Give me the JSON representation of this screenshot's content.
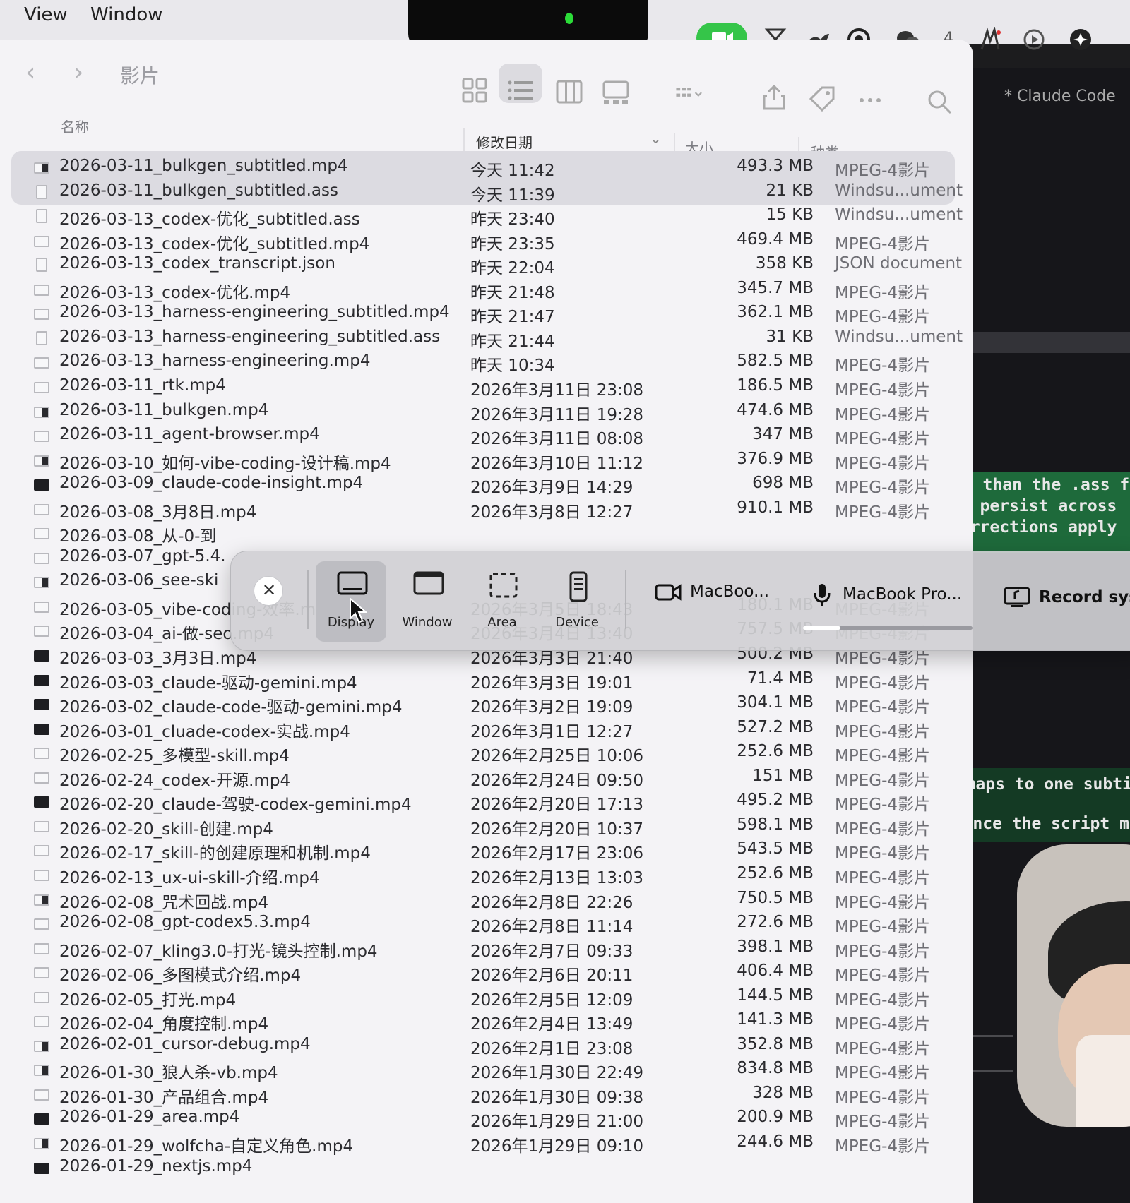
{
  "menubar": {
    "view_label": "View",
    "window_label": "Window",
    "status_count": "4"
  },
  "finder": {
    "title": "影片",
    "columns": {
      "name": "名称",
      "date": "修改日期",
      "size": "大小",
      "kind": "种类"
    },
    "rows": [
      {
        "name": "2026-03-11_bulkgen_subtitled.mp4",
        "date": "今天 11:42",
        "size": "493.3 MB",
        "kind": "MPEG-4影片",
        "icon": "video-thumb",
        "selected": true
      },
      {
        "name": "2026-03-11_bulkgen_subtitled.ass",
        "date": "今天 11:39",
        "size": "21 KB",
        "kind": "Windsu...ument",
        "icon": "doc"
      },
      {
        "name": "2026-03-13_codex-优化_subtitled.ass",
        "date": "昨天 23:40",
        "size": "15 KB",
        "kind": "Windsu...ument",
        "icon": "doc"
      },
      {
        "name": "2026-03-13_codex-优化_subtitled.mp4",
        "date": "昨天 23:35",
        "size": "469.4 MB",
        "kind": "MPEG-4影片",
        "icon": "video"
      },
      {
        "name": "2026-03-13_codex_transcript.json",
        "date": "昨天 22:04",
        "size": "358 KB",
        "kind": "JSON document",
        "icon": "doc"
      },
      {
        "name": "2026-03-13_codex-优化.mp4",
        "date": "昨天 21:48",
        "size": "345.7 MB",
        "kind": "MPEG-4影片",
        "icon": "video"
      },
      {
        "name": "2026-03-13_harness-engineering_subtitled.mp4",
        "date": "昨天 21:47",
        "size": "362.1 MB",
        "kind": "MPEG-4影片",
        "icon": "video"
      },
      {
        "name": "2026-03-13_harness-engineering_subtitled.ass",
        "date": "昨天 21:44",
        "size": "31 KB",
        "kind": "Windsu...ument",
        "icon": "doc"
      },
      {
        "name": "2026-03-13_harness-engineering.mp4",
        "date": "昨天 10:34",
        "size": "582.5 MB",
        "kind": "MPEG-4影片",
        "icon": "video"
      },
      {
        "name": "2026-03-11_rtk.mp4",
        "date": "2026年3月11日 23:08",
        "size": "186.5 MB",
        "kind": "MPEG-4影片",
        "icon": "video"
      },
      {
        "name": "2026-03-11_bulkgen.mp4",
        "date": "2026年3月11日 19:28",
        "size": "474.6 MB",
        "kind": "MPEG-4影片",
        "icon": "video-thumb"
      },
      {
        "name": "2026-03-11_agent-browser.mp4",
        "date": "2026年3月11日 08:08",
        "size": "347 MB",
        "kind": "MPEG-4影片",
        "icon": "video"
      },
      {
        "name": "2026-03-10_如何-vibe-coding-设计稿.mp4",
        "date": "2026年3月10日 11:12",
        "size": "376.9 MB",
        "kind": "MPEG-4影片",
        "icon": "video-thumb"
      },
      {
        "name": "2026-03-09_claude-code-insight.mp4",
        "date": "2026年3月9日 14:29",
        "size": "698 MB",
        "kind": "MPEG-4影片",
        "icon": "video-dark"
      },
      {
        "name": "2026-03-08_3月8日.mp4",
        "date": "2026年3月8日 12:27",
        "size": "910.1 MB",
        "kind": "MPEG-4影片",
        "icon": "video"
      },
      {
        "name": "2026-03-08_从-0-到",
        "date": "",
        "size": "",
        "kind": "",
        "icon": "video"
      },
      {
        "name": "2026-03-07_gpt-5.4.",
        "date": "",
        "size": "",
        "kind": "",
        "icon": "video"
      },
      {
        "name": "2026-03-06_see-ski",
        "date": "",
        "size": "",
        "kind": "",
        "icon": "video-thumb"
      },
      {
        "name": "2026-03-05_vibe-coding-效率.mp4",
        "date": "2026年3月5日 18:43",
        "size": "180.1 MB",
        "kind": "MPEG-4影片",
        "icon": "video"
      },
      {
        "name": "2026-03-04_ai-做-seo.mp4",
        "date": "2026年3月4日 13:40",
        "size": "757.5 MB",
        "kind": "MPEG-4影片",
        "icon": "video"
      },
      {
        "name": "2026-03-03_3月3日.mp4",
        "date": "2026年3月3日 21:40",
        "size": "500.2 MB",
        "kind": "MPEG-4影片",
        "icon": "video-dark"
      },
      {
        "name": "2026-03-03_claude-驱动-gemini.mp4",
        "date": "2026年3月3日 19:01",
        "size": "71.4 MB",
        "kind": "MPEG-4影片",
        "icon": "video-dark"
      },
      {
        "name": "2026-03-02_claude-code-驱动-gemini.mp4",
        "date": "2026年3月2日 19:09",
        "size": "304.1 MB",
        "kind": "MPEG-4影片",
        "icon": "video-dark"
      },
      {
        "name": "2026-03-01_cluade-codex-实战.mp4",
        "date": "2026年3月1日 12:27",
        "size": "527.2 MB",
        "kind": "MPEG-4影片",
        "icon": "video-dark"
      },
      {
        "name": "2026-02-25_多模型-skill.mp4",
        "date": "2026年2月25日 10:06",
        "size": "252.6 MB",
        "kind": "MPEG-4影片",
        "icon": "video"
      },
      {
        "name": "2026-02-24_codex-开源.mp4",
        "date": "2026年2月24日 09:50",
        "size": "151 MB",
        "kind": "MPEG-4影片",
        "icon": "video"
      },
      {
        "name": "2026-02-20_claude-驾驶-codex-gemini.mp4",
        "date": "2026年2月20日 17:13",
        "size": "495.2 MB",
        "kind": "MPEG-4影片",
        "icon": "video-dark"
      },
      {
        "name": "2026-02-20_skill-创建.mp4",
        "date": "2026年2月20日 10:37",
        "size": "598.1 MB",
        "kind": "MPEG-4影片",
        "icon": "video"
      },
      {
        "name": "2026-02-17_skill-的创建原理和机制.mp4",
        "date": "2026年2月17日 23:06",
        "size": "543.5 MB",
        "kind": "MPEG-4影片",
        "icon": "video"
      },
      {
        "name": "2026-02-13_ux-ui-skill-介绍.mp4",
        "date": "2026年2月13日 13:03",
        "size": "252.6 MB",
        "kind": "MPEG-4影片",
        "icon": "video"
      },
      {
        "name": "2026-02-08_咒术回战.mp4",
        "date": "2026年2月8日 22:26",
        "size": "750.5 MB",
        "kind": "MPEG-4影片",
        "icon": "video-thumb"
      },
      {
        "name": "2026-02-08_gpt-codex5.3.mp4",
        "date": "2026年2月8日 11:14",
        "size": "272.6 MB",
        "kind": "MPEG-4影片",
        "icon": "video"
      },
      {
        "name": "2026-02-07_kling3.0-打光-镜头控制.mp4",
        "date": "2026年2月7日 09:33",
        "size": "398.1 MB",
        "kind": "MPEG-4影片",
        "icon": "video"
      },
      {
        "name": "2026-02-06_多图模式介绍.mp4",
        "date": "2026年2月6日 20:11",
        "size": "406.4 MB",
        "kind": "MPEG-4影片",
        "icon": "video"
      },
      {
        "name": "2026-02-05_打光.mp4",
        "date": "2026年2月5日 12:09",
        "size": "144.5 MB",
        "kind": "MPEG-4影片",
        "icon": "video"
      },
      {
        "name": "2026-02-04_角度控制.mp4",
        "date": "2026年2月4日 13:49",
        "size": "141.3 MB",
        "kind": "MPEG-4影片",
        "icon": "video"
      },
      {
        "name": "2026-02-01_cursor-debug.mp4",
        "date": "2026年2月1日 23:08",
        "size": "352.8 MB",
        "kind": "MPEG-4影片",
        "icon": "video-thumb"
      },
      {
        "name": "2026-01-30_狼人杀-vb.mp4",
        "date": "2026年1月30日 22:49",
        "size": "834.8 MB",
        "kind": "MPEG-4影片",
        "icon": "video-thumb"
      },
      {
        "name": "2026-01-30_产品组合.mp4",
        "date": "2026年1月30日 09:38",
        "size": "328 MB",
        "kind": "MPEG-4影片",
        "icon": "video"
      },
      {
        "name": "2026-01-29_area.mp4",
        "date": "2026年1月29日 21:00",
        "size": "200.9 MB",
        "kind": "MPEG-4影片",
        "icon": "video-dark"
      },
      {
        "name": "2026-01-29_wolfcha-自定义角色.mp4",
        "date": "2026年1月29日 09:10",
        "size": "244.6 MB",
        "kind": "MPEG-4影片",
        "icon": "video-thumb"
      },
      {
        "name": "2026-01-29_nextjs.mp4",
        "date": "",
        "size": "",
        "kind": "",
        "icon": "video-dark"
      }
    ]
  },
  "capture_toolbar": {
    "display_label": "Display",
    "window_label": "Window",
    "area_label": "Area",
    "device_label": "Device",
    "camera_label": "MacBoo...",
    "mic_label": "MacBook Pro...",
    "record_system_label": "Record syst",
    "mic_level": 0.22
  },
  "terminal": {
    "title": "* Claude Code",
    "lines": [
      "er than the .ass f",
      "pt persist across",
      "corrections apply",
      "on maps to one subti",
      "t since the script m"
    ]
  },
  "colors": {
    "record_green": "#35c549",
    "terminal_highlight": "#1e6a3b",
    "selected_row": "#dcdbe1"
  }
}
